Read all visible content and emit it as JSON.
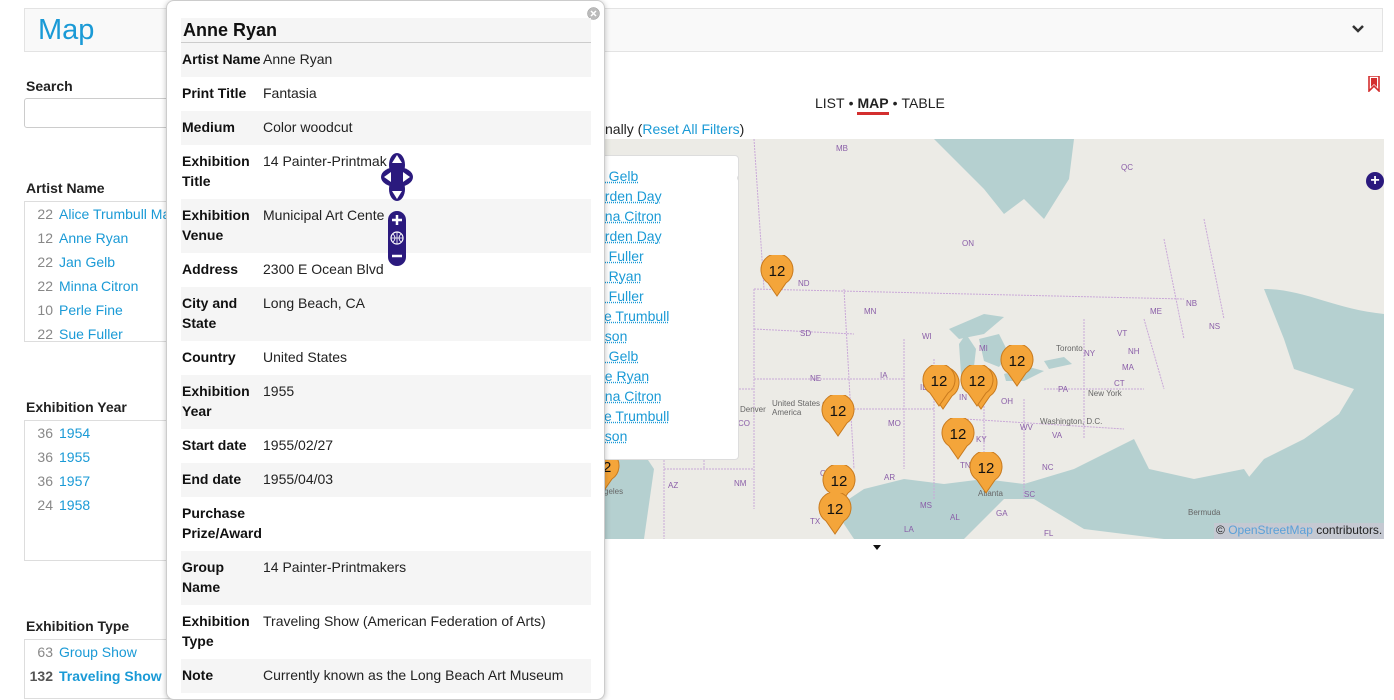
{
  "header": {
    "title": "Map"
  },
  "sidebar": {
    "search_label": "Search",
    "search_placeholder": "",
    "artist_facet": {
      "label": "Artist Name",
      "items": [
        {
          "count": "22",
          "label": "Alice Trumbull Ma"
        },
        {
          "count": "12",
          "label": "Anne Ryan"
        },
        {
          "count": "22",
          "label": "Jan Gelb"
        },
        {
          "count": "22",
          "label": "Minna Citron"
        },
        {
          "count": "10",
          "label": "Perle Fine"
        },
        {
          "count": "22",
          "label": "Sue Fuller"
        }
      ]
    },
    "year_facet": {
      "label": "Exhibition Year",
      "items": [
        {
          "count": "36",
          "label": "1954"
        },
        {
          "count": "36",
          "label": "1955"
        },
        {
          "count": "36",
          "label": "1957"
        },
        {
          "count": "24",
          "label": "1958"
        }
      ]
    },
    "type_facet": {
      "label": "Exhibition Type",
      "items": [
        {
          "count": "63",
          "label": "Group Show"
        },
        {
          "count": "132",
          "label": "Traveling Show"
        }
      ]
    }
  },
  "view_nav": {
    "list": "LIST",
    "map": "MAP",
    "table": "TABLE",
    "separator": "•"
  },
  "filter_line": {
    "prefix": "nally (",
    "reset_label": "Reset All Filters",
    "suffix": ")"
  },
  "map": {
    "labels": [
      {
        "text": "MB"
      },
      {
        "text": "QC"
      },
      {
        "text": "ON"
      },
      {
        "text": "ND"
      },
      {
        "text": "SD"
      },
      {
        "text": "MN"
      },
      {
        "text": "WI"
      },
      {
        "text": "MI"
      },
      {
        "text": "NE"
      },
      {
        "text": "IA"
      },
      {
        "text": "IL"
      },
      {
        "text": "IN"
      },
      {
        "text": "OH"
      },
      {
        "text": "PA"
      },
      {
        "text": "NY"
      },
      {
        "text": "VT"
      },
      {
        "text": "NH"
      },
      {
        "text": "ME"
      },
      {
        "text": "NB"
      },
      {
        "text": "NS"
      },
      {
        "text": "MA"
      },
      {
        "text": "CT"
      },
      {
        "text": "MO"
      },
      {
        "text": "KY"
      },
      {
        "text": "WV"
      },
      {
        "text": "VA"
      },
      {
        "text": "NC"
      },
      {
        "text": "TN"
      },
      {
        "text": "SC"
      },
      {
        "text": "GA"
      },
      {
        "text": "AL"
      },
      {
        "text": "MS"
      },
      {
        "text": "AR"
      },
      {
        "text": "OK"
      },
      {
        "text": "TX"
      },
      {
        "text": "NM"
      },
      {
        "text": "AZ"
      },
      {
        "text": "CO"
      },
      {
        "text": "LA"
      },
      {
        "text": "FL"
      },
      {
        "text": "Toronto"
      },
      {
        "text": "New York"
      },
      {
        "text": "Washington, D.C."
      },
      {
        "text": "Denver"
      },
      {
        "text": "United States of America"
      },
      {
        "text": "Atlanta"
      },
      {
        "text": "Bermuda"
      },
      {
        "text": "geles"
      }
    ],
    "marker_label": "12",
    "marker_color": "#f4a53a",
    "attribution_prefix": "© ",
    "attribution_link": "OpenStreetMap",
    "attribution_suffix": " contributors."
  },
  "list_popup": {
    "entries": [
      "n Gelb",
      "orden Day",
      "nna Citron",
      "orden Day",
      "e Fuller",
      "e Ryan",
      "e Fuller",
      "ce Trumbull",
      "ason",
      "n Gelb",
      "ne Ryan",
      "nna Citron",
      "ce Trumbull",
      "ason"
    ]
  },
  "detail_popup": {
    "title": "Anne Ryan",
    "fields": [
      {
        "key": "Artist Name",
        "value": "Anne Ryan"
      },
      {
        "key": "Print Title",
        "value": "Fantasia"
      },
      {
        "key": "Medium",
        "value": "Color woodcut"
      },
      {
        "key": "Exhibition Title",
        "value": "14 Painter-Printmak"
      },
      {
        "key": "Exhibition Venue",
        "value": "Municipal Art Cente"
      },
      {
        "key": "Address",
        "value": "2300 E Ocean Blvd"
      },
      {
        "key": "City and State",
        "value": "Long Beach, CA"
      },
      {
        "key": "Country",
        "value": "United States"
      },
      {
        "key": "Exhibition Year",
        "value": "1955"
      },
      {
        "key": "Start date",
        "value": "1955/02/27"
      },
      {
        "key": "End date",
        "value": "1955/04/03"
      },
      {
        "key": "Purchase Prize/Award",
        "value": ""
      },
      {
        "key": "Group Name",
        "value": "14 Painter-Printmakers"
      },
      {
        "key": "Exhibition Type",
        "value": "Traveling Show (American Federation of Arts)"
      },
      {
        "key": "Note",
        "value": "Currently known as the Long Beach Art Museum"
      }
    ]
  }
}
